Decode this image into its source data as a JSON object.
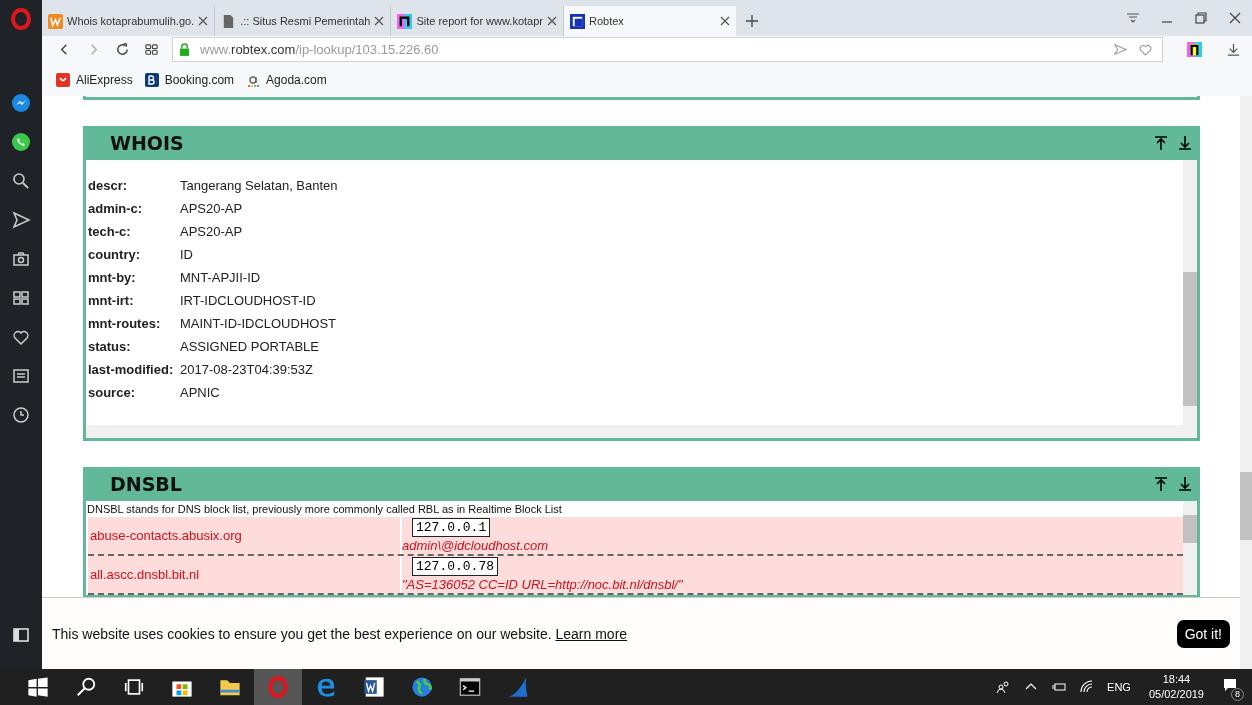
{
  "browser": {
    "tabs": [
      {
        "title": "Whois kotaprabumulih.go.",
        "selected": false
      },
      {
        "title": ".:: Situs Resmi Pemerintah",
        "selected": false
      },
      {
        "title": "Site report for www.kotapr",
        "selected": false
      },
      {
        "title": "Robtex",
        "selected": true
      }
    ],
    "url": {
      "prefix": "www.",
      "domain": "robtex.com",
      "path": "/ip-lookup/103.15.226.60"
    },
    "bookmarks": [
      {
        "label": "AliExpress"
      },
      {
        "label": "Booking.com"
      },
      {
        "label": "Agoda.com"
      }
    ]
  },
  "whois": {
    "title": "WHOIS",
    "rows": [
      {
        "key": "descr:",
        "value": "Tangerang Selatan, Banten"
      },
      {
        "key": "admin-c:",
        "value": "APS20-AP"
      },
      {
        "key": "tech-c:",
        "value": "APS20-AP"
      },
      {
        "key": "country:",
        "value": "ID"
      },
      {
        "key": "mnt-by:",
        "value": "MNT-APJII-ID"
      },
      {
        "key": "mnt-irt:",
        "value": "IRT-IDCLOUDHOST-ID"
      },
      {
        "key": "mnt-routes:",
        "value": "MAINT-ID-IDCLOUDHOST"
      },
      {
        "key": "status:",
        "value": "ASSIGNED PORTABLE"
      },
      {
        "key": "last-modified:",
        "value": "2017-08-23T04:39:53Z"
      },
      {
        "key": "source:",
        "value": "APNIC"
      }
    ]
  },
  "dnsbl": {
    "title": "DNSBL",
    "description": "DNSBL stands for DNS block list, previously more commonly called RBL as in Realtime Block List",
    "rows": [
      {
        "host": "abuse-contacts.abusix.org",
        "ip": "127.0.0.1",
        "note": "admin\\@idcloudhost.com"
      },
      {
        "host": "all.ascc.dnsbl.bit.nl",
        "ip": "127.0.0.78",
        "note": "\"AS=136052 CC=ID URL=http://noc.bit.nl/dnsbl/\""
      }
    ]
  },
  "cookie_banner": {
    "text": "This website uses cookies to ensure you get the best experience on our website.",
    "link": "Learn more",
    "button": "Got it!"
  },
  "taskbar": {
    "language": "ENG",
    "time": "18:44",
    "date": "05/02/2019",
    "notifications": "8"
  }
}
